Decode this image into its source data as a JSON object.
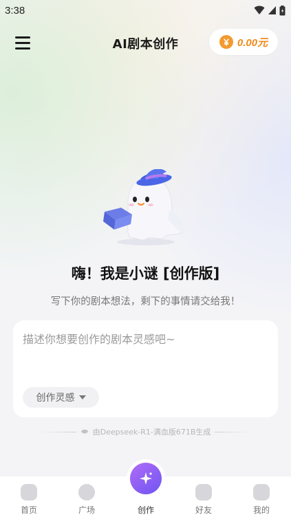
{
  "status_bar": {
    "time": "3:38"
  },
  "header": {
    "title": "AI剧本创作",
    "balance": "0.00元"
  },
  "hero": {
    "greeting": "嗨！我是小谜 [创作版]",
    "subtitle": "写下你的剧本想法，剩下的事情请交给我！"
  },
  "prompt": {
    "placeholder": "描述你想要创作的剧本灵感吧~",
    "chip_label": "创作灵感"
  },
  "model_note": "由Deepseek-R1-满血版671B生成",
  "tabs": [
    {
      "label": "首页",
      "icon": "home-icon"
    },
    {
      "label": "广场",
      "icon": "plaza-icon"
    },
    {
      "label": "创作",
      "icon": "sparkle-icon"
    },
    {
      "label": "好友",
      "icon": "friends-icon"
    },
    {
      "label": "我的",
      "icon": "profile-icon"
    }
  ],
  "colors": {
    "accent": "#8a5cf5",
    "coin": "#f29a2e",
    "balance_text": "#f08a1a"
  }
}
